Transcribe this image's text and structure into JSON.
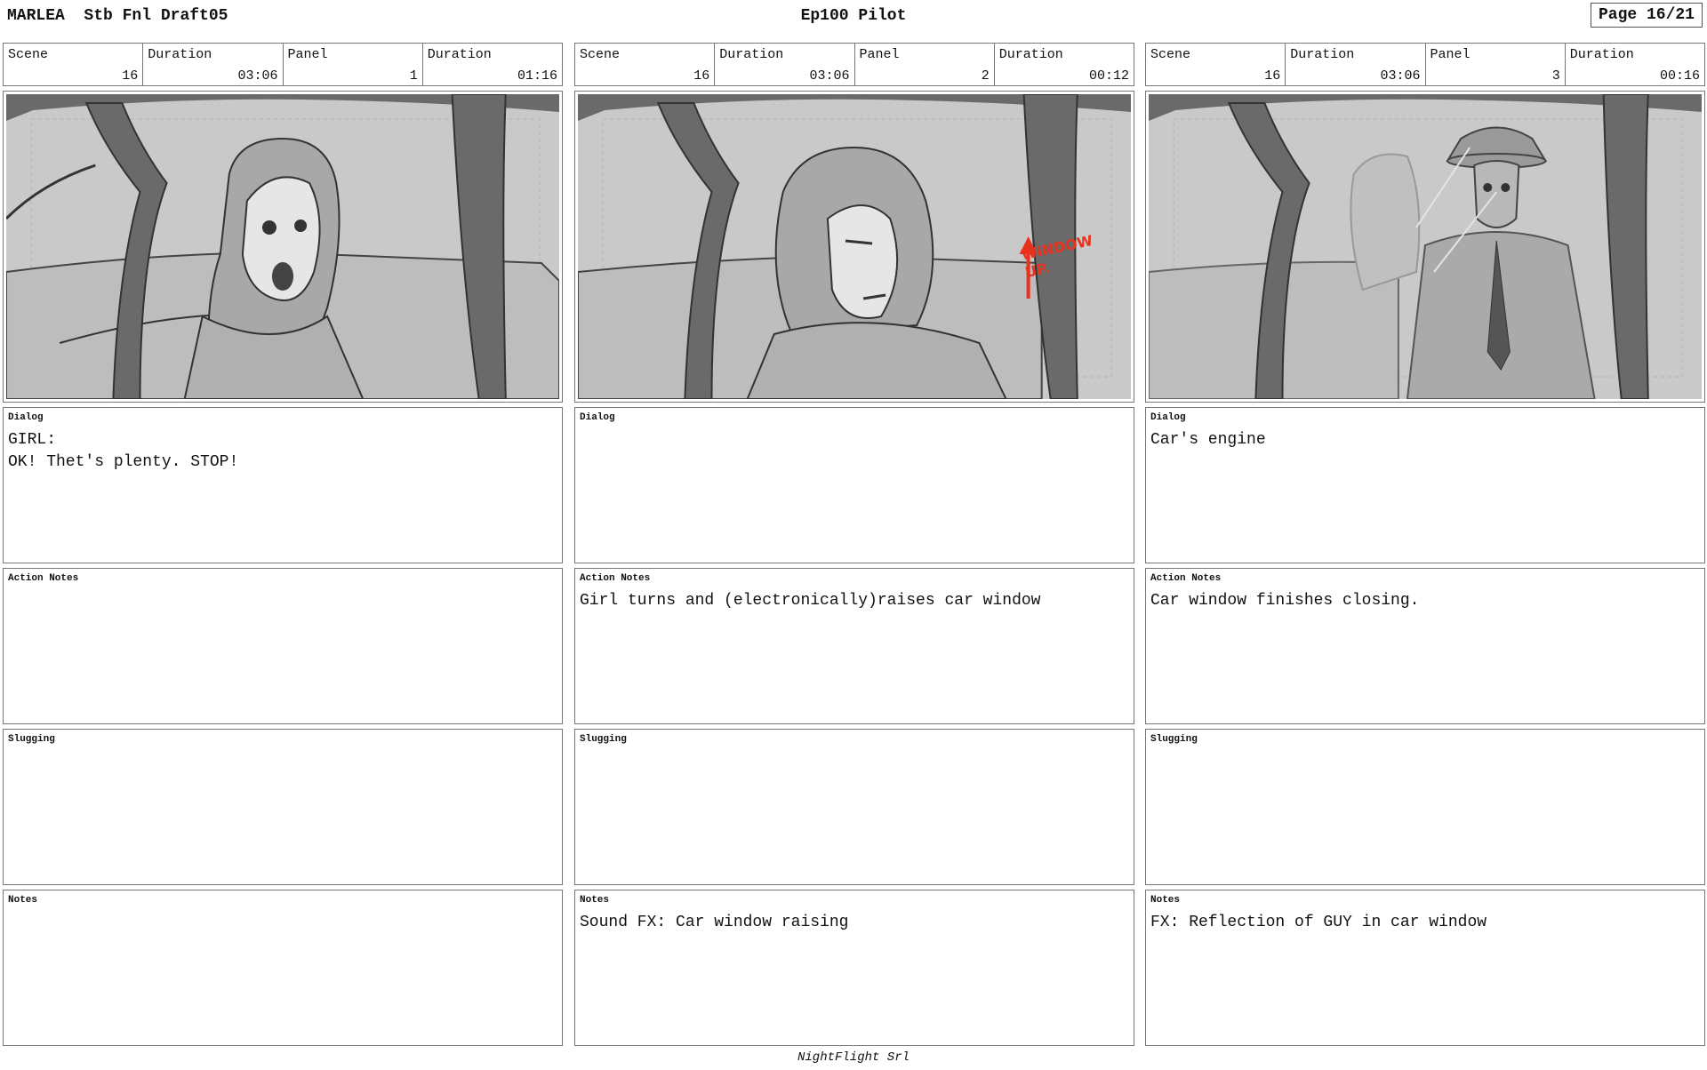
{
  "header": {
    "production": "MARLEA",
    "draft": "Stb Fnl Draft05",
    "episode": "Ep100 Pilot",
    "page": "Page 16/21"
  },
  "meta_labels": {
    "scene": "Scene",
    "duration": "Duration",
    "panel": "Panel"
  },
  "field_labels": {
    "dialog": "Dialog",
    "action_notes": "Action Notes",
    "slugging": "Slugging",
    "notes": "Notes"
  },
  "panels": [
    {
      "scene": "16",
      "scene_duration": "03:06",
      "panel": "1",
      "panel_duration": "01:16",
      "dialog": "GIRL:\nOK! Thet's plenty. STOP!",
      "action_notes": "",
      "slugging": "",
      "notes": ""
    },
    {
      "scene": "16",
      "scene_duration": "03:06",
      "panel": "2",
      "panel_duration": "00:12",
      "dialog": "",
      "action_notes": "Girl turns and (electronically)raises car window",
      "slugging": "",
      "notes": "Sound FX: Car window raising",
      "annotation": "WINDOW UP."
    },
    {
      "scene": "16",
      "scene_duration": "03:06",
      "panel": "3",
      "panel_duration": "00:16",
      "dialog": "Car's engine",
      "action_notes": "Car window finishes closing.",
      "slugging": "",
      "notes": "FX: Reflection of GUY in car window"
    }
  ],
  "colors": {
    "annotation_red": "#e8321e",
    "frame_bg": "#c8c8c8",
    "pillar": "#6a6a6a"
  },
  "footer": "NightFlight Srl"
}
